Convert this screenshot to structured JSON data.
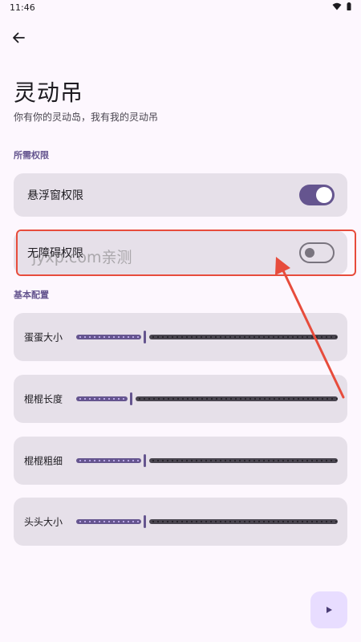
{
  "status_bar": {
    "time": "11:46",
    "icons": [
      "wifi-icon",
      "battery-icon"
    ]
  },
  "header": {
    "back_icon": "arrow-left-icon"
  },
  "title": "灵动吊",
  "subtitle": "你有你的灵动岛，我有我的灵动吊",
  "sections": {
    "permissions": {
      "label": "所需权限",
      "items": [
        {
          "label": "悬浮窗权限",
          "enabled": true
        },
        {
          "label": "无障碍权限",
          "enabled": false
        }
      ]
    },
    "config": {
      "label": "基本配置",
      "sliders": [
        {
          "label": "蛋蛋大小",
          "value": 0.26
        },
        {
          "label": "棍棍长度",
          "value": 0.21
        },
        {
          "label": "棍棍粗细",
          "value": 0.26
        },
        {
          "label": "头头大小",
          "value": 0.26
        }
      ]
    }
  },
  "watermark": "jyxp.com亲测",
  "fab": {
    "icon": "play-icon"
  },
  "colors": {
    "accent": "#65558f",
    "card": "#e6e0e9",
    "background": "#fdf7fe",
    "annotation": "#e74c3c"
  }
}
